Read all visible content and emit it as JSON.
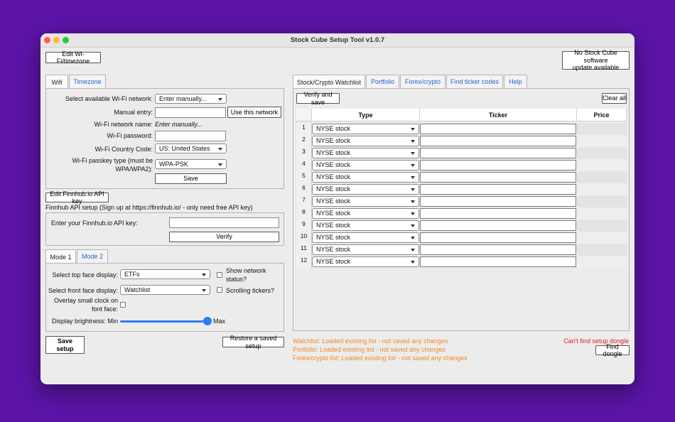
{
  "window": {
    "title": "Stock Cube Setup Tool v1.0.7",
    "traffic_colors": [
      "#ff5f57",
      "#febc2e",
      "#28c840"
    ]
  },
  "header": {
    "edit_wifi_button": "Edit Wi-Fi/timezone",
    "update_status_line1": "No Stock Cube software",
    "update_status_line2": "update available"
  },
  "wifi": {
    "tabs": [
      "Wifi",
      "Timezone"
    ],
    "active_tab": "Wifi",
    "select_network_label": "Select available Wi-Fi network:",
    "select_network_value": "Enter manually...",
    "manual_entry_label": "Manual entry:",
    "manual_entry_value": "",
    "use_network_button": "Use this network",
    "network_name_label": "Wi-Fi network name:",
    "network_name_value": "Enter manually...",
    "password_label": "Wi-Fi password:",
    "password_value": "",
    "country_label": "Wi-Fi Country Code:",
    "country_value": "US: United States",
    "passkey_label_line1": "Wi-Fi passkey type (must be",
    "passkey_label_line2": "WPA/WPA2):",
    "passkey_value": "WPA-PSK",
    "save_button": "Save"
  },
  "finnhub": {
    "edit_button": "Edit Finnhub.io API key",
    "setup_text": "Finnhub API setup (Sign up at https://finnhub.io/ - only need free API key)",
    "api_key_label": "Enter your Finnhub.io API key:",
    "api_key_value": "",
    "verify_button": "Verify"
  },
  "mode": {
    "tabs": [
      "Mode 1",
      "Mode 2"
    ],
    "active_tab": "Mode 1",
    "top_face_label": "Select top face display:",
    "top_face_value": "ETFs",
    "show_network_line1": "Show network",
    "show_network_line2": "status?",
    "front_face_label": "Select front face display:",
    "front_face_value": "Watchlist",
    "scrolling_label": "Scrolling tickers?",
    "overlay_label_line1": "Overlay small clock on",
    "overlay_label_line2": "font face:",
    "brightness_label": "Display brightness: Min",
    "brightness_max_label": "Max",
    "brightness_level": 1.0
  },
  "bottom_left": {
    "save_setup_line1": "Save",
    "save_setup_line2": "setup",
    "restore_button": "Restore a saved setup"
  },
  "right_panel": {
    "tabs": [
      "Stock/Crypto Watchlist",
      "Portfolio",
      "Forex/crypto",
      "Find ticker codes",
      "Help"
    ],
    "active_tab": "Stock/Crypto Watchlist",
    "verify_save_button": "Verify and save",
    "clear_all_button": "Clear all",
    "columns": [
      "Type",
      "Ticker",
      "Price"
    ],
    "rows": [
      {
        "num": "1",
        "type": "NYSE stock",
        "ticker": "",
        "price": ""
      },
      {
        "num": "2",
        "type": "NYSE stock",
        "ticker": "",
        "price": ""
      },
      {
        "num": "3",
        "type": "NYSE stock",
        "ticker": "",
        "price": ""
      },
      {
        "num": "4",
        "type": "NYSE stock",
        "ticker": "",
        "price": ""
      },
      {
        "num": "5",
        "type": "NYSE stock",
        "ticker": "",
        "price": ""
      },
      {
        "num": "6",
        "type": "NYSE stock",
        "ticker": "",
        "price": ""
      },
      {
        "num": "7",
        "type": "NYSE stock",
        "ticker": "",
        "price": ""
      },
      {
        "num": "8",
        "type": "NYSE stock",
        "ticker": "",
        "price": ""
      },
      {
        "num": "9",
        "type": "NYSE stock",
        "ticker": "",
        "price": ""
      },
      {
        "num": "10",
        "type": "NYSE stock",
        "ticker": "",
        "price": ""
      },
      {
        "num": "11",
        "type": "NYSE stock",
        "ticker": "",
        "price": ""
      },
      {
        "num": "12",
        "type": "NYSE stock",
        "ticker": "",
        "price": ""
      }
    ]
  },
  "status": {
    "watchlist": "Watchlist: Loaded existing list - not saved any changes",
    "portfolio": "Portfolio: Loaded existing list - not saved any changes",
    "forex": "Forex/crypto list: Loaded existing list - not saved any changes",
    "dongle_error": "Can't find setup dongle",
    "find_dongle_button": "Find dongle",
    "status_color": "#f08a24",
    "error_color": "#e02020"
  },
  "colors": {
    "background": "#5b14a6",
    "accent": "#2f7bf5",
    "tab_text": "#2a63c9"
  }
}
